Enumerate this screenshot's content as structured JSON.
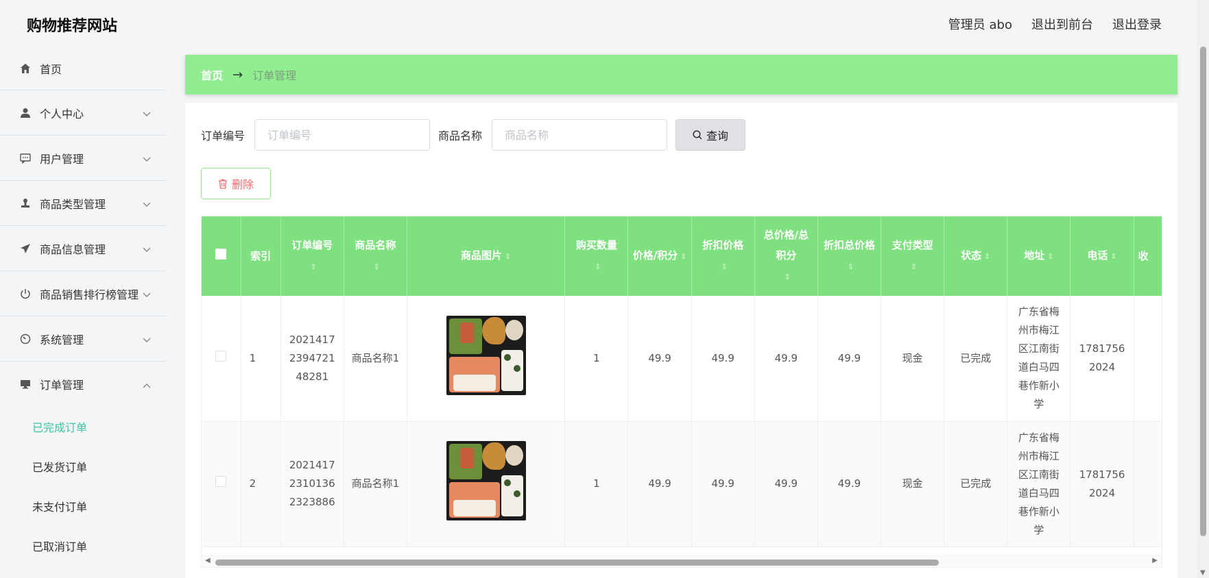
{
  "header": {
    "site_title": "购物推荐网站",
    "admin_label": "管理员 abo",
    "front_link": "退出到前台",
    "logout_link": "退出登录"
  },
  "sidebar": {
    "items": [
      {
        "label": "首页",
        "icon": "home-icon",
        "expandable": false
      },
      {
        "label": "个人中心",
        "icon": "user-icon",
        "expandable": true
      },
      {
        "label": "用户管理",
        "icon": "chat-icon",
        "expandable": true
      },
      {
        "label": "商品类型管理",
        "icon": "stamp-icon",
        "expandable": true
      },
      {
        "label": "商品信息管理",
        "icon": "send-icon",
        "expandable": true
      },
      {
        "label": "商品销售排行榜管理",
        "icon": "power-icon",
        "expandable": true
      },
      {
        "label": "系统管理",
        "icon": "gauge-icon",
        "expandable": true
      },
      {
        "label": "订单管理",
        "icon": "monitor-icon",
        "expandable": true,
        "expanded": true
      }
    ],
    "subitems": [
      {
        "label": "已完成订单",
        "active": true
      },
      {
        "label": "已发货订单",
        "active": false
      },
      {
        "label": "未支付订单",
        "active": false
      },
      {
        "label": "已取消订单",
        "active": false
      }
    ]
  },
  "breadcrumb": {
    "home": "首页",
    "arrow": "→",
    "current": "订单管理"
  },
  "search": {
    "order_no_label": "订单编号",
    "order_no_placeholder": "订单编号",
    "product_label": "商品名称",
    "product_placeholder": "商品名称",
    "query_label": "查询"
  },
  "actions": {
    "delete_label": "删除"
  },
  "table": {
    "headers": [
      "索引",
      "订单编号",
      "商品名称",
      "商品图片",
      "购买数量",
      "价格/积分",
      "折扣价格",
      "总价格/总积分",
      "折扣总价格",
      "支付类型",
      "状态",
      "地址",
      "电话",
      "收"
    ],
    "rows": [
      {
        "index": "1",
        "order_no": "2021417239472148281",
        "product": "商品名称1",
        "qty": "1",
        "price": "49.9",
        "discount_price": "49.9",
        "total": "49.9",
        "discount_total": "49.9",
        "pay_type": "现金",
        "status": "已完成",
        "address": "广东省梅州市梅江区江南街道白马四巷作新小学",
        "phone": "17817562024"
      },
      {
        "index": "2",
        "order_no": "20214172310136 2323886",
        "product": "商品名称1",
        "qty": "1",
        "price": "49.9",
        "discount_price": "49.9",
        "total": "49.9",
        "discount_total": "49.9",
        "pay_type": "现金",
        "status": "已完成",
        "address": "广东省梅州市梅江区江南街道白马四巷作新小学",
        "phone": "17817562024"
      }
    ]
  },
  "colors": {
    "accent": "#90ee90",
    "header_green": "#7ee07e",
    "active_menu": "#3cc3a3",
    "danger": "#f56c6c"
  }
}
